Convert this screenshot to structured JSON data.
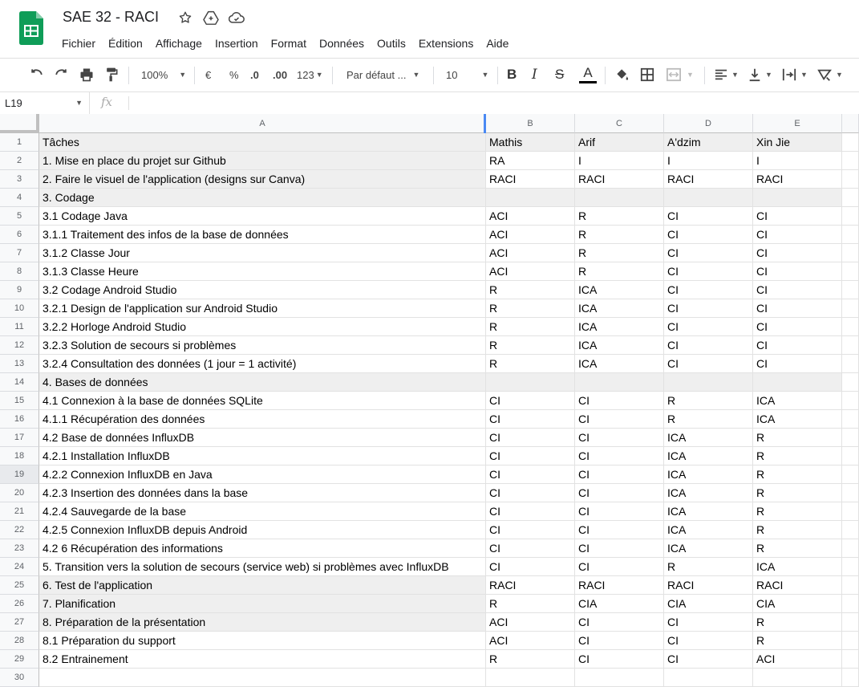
{
  "app": {
    "title": "SAE 32 - RACI",
    "brand_color": "#0f9d58"
  },
  "menu": [
    "Fichier",
    "Édition",
    "Affichage",
    "Insertion",
    "Format",
    "Données",
    "Outils",
    "Extensions",
    "Aide"
  ],
  "toolbar": {
    "zoom": "100%",
    "currency": "€",
    "percent": "%",
    "dec_decrease": ".0",
    "dec_increase": ".00",
    "more_formats": "123",
    "font": "Par défaut ...",
    "font_size": "10"
  },
  "formula_bar": {
    "cell_ref": "L19",
    "fx": "fx",
    "content": ""
  },
  "sheet": {
    "columns": [
      "A",
      "B",
      "C",
      "D",
      "E"
    ],
    "selected_row": 19,
    "rows": [
      {
        "n": "1",
        "shade": "header",
        "cells": [
          "Tâches",
          "Mathis",
          "Arif",
          "A'dzim",
          "Xin Jie"
        ]
      },
      {
        "n": "2",
        "shade": "a",
        "cells": [
          "1. Mise en place du projet sur Github",
          "RA",
          "I",
          "I",
          "I"
        ]
      },
      {
        "n": "3",
        "shade": "a",
        "cells": [
          "2. Faire le visuel de l'application (designs sur Canva)",
          "RACI",
          "RACI",
          "RACI",
          "RACI"
        ]
      },
      {
        "n": "4",
        "shade": "all",
        "cells": [
          "3. Codage",
          "",
          "",
          "",
          ""
        ]
      },
      {
        "n": "5",
        "shade": "none",
        "cells": [
          "3.1 Codage Java",
          "ACI",
          "R",
          "CI",
          "CI"
        ]
      },
      {
        "n": "6",
        "shade": "none",
        "cells": [
          "3.1.1 Traitement des infos de la base de données",
          "ACI",
          "R",
          "CI",
          "CI"
        ]
      },
      {
        "n": "7",
        "shade": "none",
        "cells": [
          "3.1.2 Classe Jour",
          "ACI",
          "R",
          "CI",
          "CI"
        ]
      },
      {
        "n": "8",
        "shade": "none",
        "cells": [
          "3.1.3 Classe Heure",
          "ACI",
          "R",
          "CI",
          "CI"
        ]
      },
      {
        "n": "9",
        "shade": "none",
        "cells": [
          "3.2 Codage Android Studio",
          "R",
          "ICA",
          "CI",
          "CI"
        ]
      },
      {
        "n": "10",
        "shade": "none",
        "cells": [
          "3.2.1 Design de l'application sur Android Studio",
          "R",
          "ICA",
          "CI",
          "CI"
        ]
      },
      {
        "n": "11",
        "shade": "none",
        "cells": [
          "3.2.2 Horloge Android Studio",
          "R",
          "ICA",
          "CI",
          "CI"
        ]
      },
      {
        "n": "12",
        "shade": "none",
        "cells": [
          "3.2.3 Solution de secours si problèmes",
          "R",
          "ICA",
          "CI",
          "CI"
        ]
      },
      {
        "n": "13",
        "shade": "none",
        "cells": [
          "3.2.4 Consultation des données (1 jour = 1 activité)",
          "R",
          "ICA",
          "CI",
          "CI"
        ]
      },
      {
        "n": "14",
        "shade": "all",
        "cells": [
          "4. Bases de données",
          "",
          "",
          "",
          ""
        ]
      },
      {
        "n": "15",
        "shade": "none",
        "cells": [
          "4.1 Connexion à la base de données SQLite",
          "CI",
          "CI",
          "R",
          "ICA"
        ]
      },
      {
        "n": "16",
        "shade": "none",
        "cells": [
          "4.1.1 Récupération des données",
          "CI",
          "CI",
          "R",
          "ICA"
        ]
      },
      {
        "n": "17",
        "shade": "none",
        "cells": [
          "4.2 Base de données InfluxDB",
          "CI",
          "CI",
          "ICA",
          "R"
        ]
      },
      {
        "n": "18",
        "shade": "none",
        "cells": [
          "4.2.1 Installation InfluxDB",
          "CI",
          "CI",
          "ICA",
          "R"
        ]
      },
      {
        "n": "19",
        "shade": "none",
        "cells": [
          "4.2.2 Connexion InfluxDB en Java",
          "CI",
          "CI",
          "ICA",
          "R"
        ]
      },
      {
        "n": "20",
        "shade": "none",
        "cells": [
          "4.2.3 Insertion des données dans la base",
          "CI",
          "CI",
          "ICA",
          "R"
        ]
      },
      {
        "n": "21",
        "shade": "none",
        "cells": [
          "4.2.4 Sauvegarde de la base",
          "CI",
          "CI",
          "ICA",
          "R"
        ]
      },
      {
        "n": "22",
        "shade": "none",
        "cells": [
          "4.2.5 Connexion InfluxDB depuis Android",
          "CI",
          "CI",
          "ICA",
          "R"
        ]
      },
      {
        "n": "23",
        "shade": "none",
        "cells": [
          "4.2 6 Récupération des informations",
          "CI",
          "CI",
          "ICA",
          "R"
        ]
      },
      {
        "n": "24",
        "shade": "none",
        "cells": [
          "5. Transition vers la solution de secours (service web) si problèmes avec InfluxDB",
          "CI",
          "CI",
          "R",
          "ICA"
        ]
      },
      {
        "n": "25",
        "shade": "a",
        "cells": [
          "6. Test de l'application",
          "RACI",
          "RACI",
          "RACI",
          "RACI"
        ]
      },
      {
        "n": "26",
        "shade": "a",
        "cells": [
          "7. Planification",
          "R",
          "CIA",
          "CIA",
          "CIA"
        ]
      },
      {
        "n": "27",
        "shade": "a",
        "cells": [
          "8. Préparation de la présentation",
          "ACI",
          "CI",
          "CI",
          "R"
        ]
      },
      {
        "n": "28",
        "shade": "none",
        "cells": [
          "8.1 Préparation du support",
          "ACI",
          "CI",
          "CI",
          "R"
        ]
      },
      {
        "n": "29",
        "shade": "none",
        "cells": [
          "8.2 Entrainement",
          "R",
          "CI",
          "CI",
          "ACI"
        ]
      },
      {
        "n": "30",
        "shade": "none",
        "cells": [
          "",
          "",
          "",
          "",
          ""
        ]
      }
    ]
  }
}
